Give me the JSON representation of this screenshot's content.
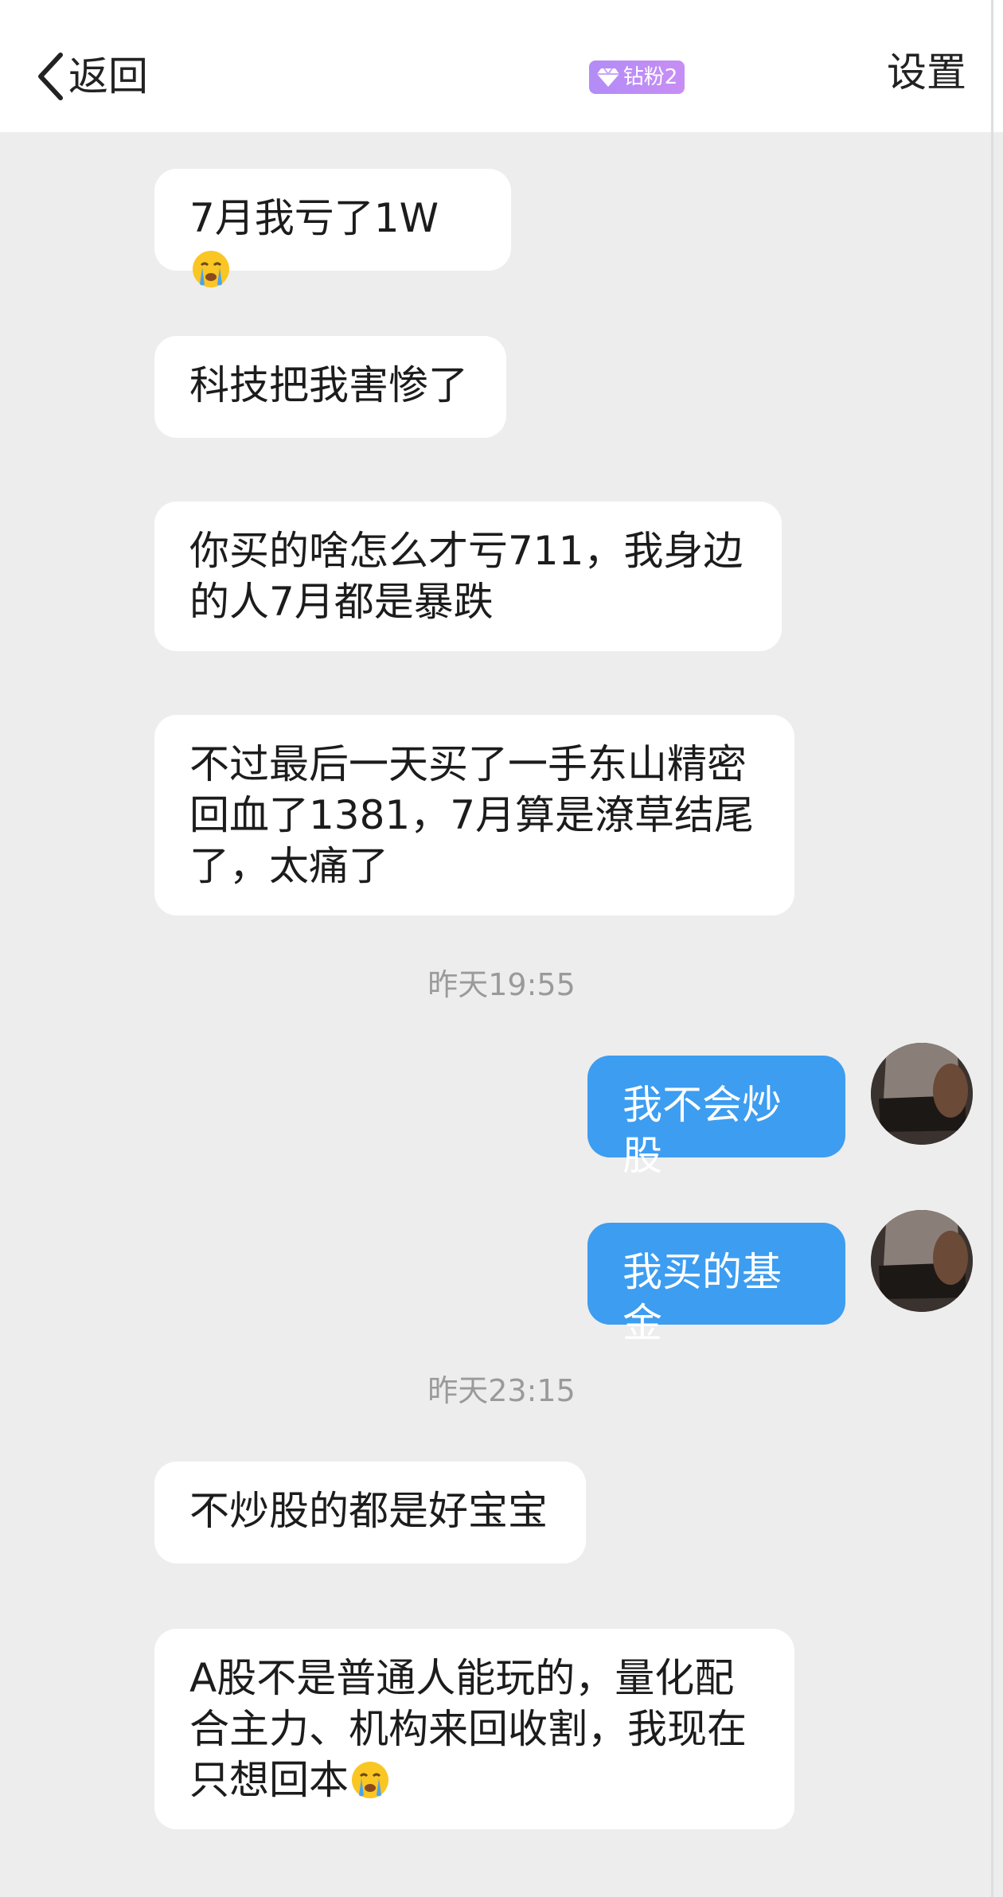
{
  "header": {
    "back_label": "返回",
    "badge_label": "钻粉2",
    "settings_label": "设置"
  },
  "messages": [
    {
      "side": "left",
      "text": "7月我亏了1W",
      "emoji": "crying-face"
    },
    {
      "side": "left",
      "text": "科技把我害惨了"
    },
    {
      "side": "left",
      "text": "你买的啥怎么才亏711，我身边的人7月都是暴跌"
    },
    {
      "side": "left",
      "text": "不过最后一天买了一手东山精密回血了1381，7月算是潦草结尾了，太痛了"
    },
    {
      "side": "time",
      "text": "昨天19:55"
    },
    {
      "side": "right",
      "text": "我不会炒股"
    },
    {
      "side": "right",
      "text": "我买的基金"
    },
    {
      "side": "time",
      "text": "昨天23:15"
    },
    {
      "side": "left",
      "text": "不炒股的都是好宝宝"
    },
    {
      "side": "left",
      "text": "A股不是普通人能玩的，量化配合主力、机构来回收割，我现在只想回本",
      "emoji": "crying-face"
    }
  ],
  "colors": {
    "background": "#ededed",
    "header_bg": "#ffffff",
    "my_bubble": "#3d9df0",
    "their_bubble": "#ffffff",
    "badge": "#b38cf6"
  }
}
